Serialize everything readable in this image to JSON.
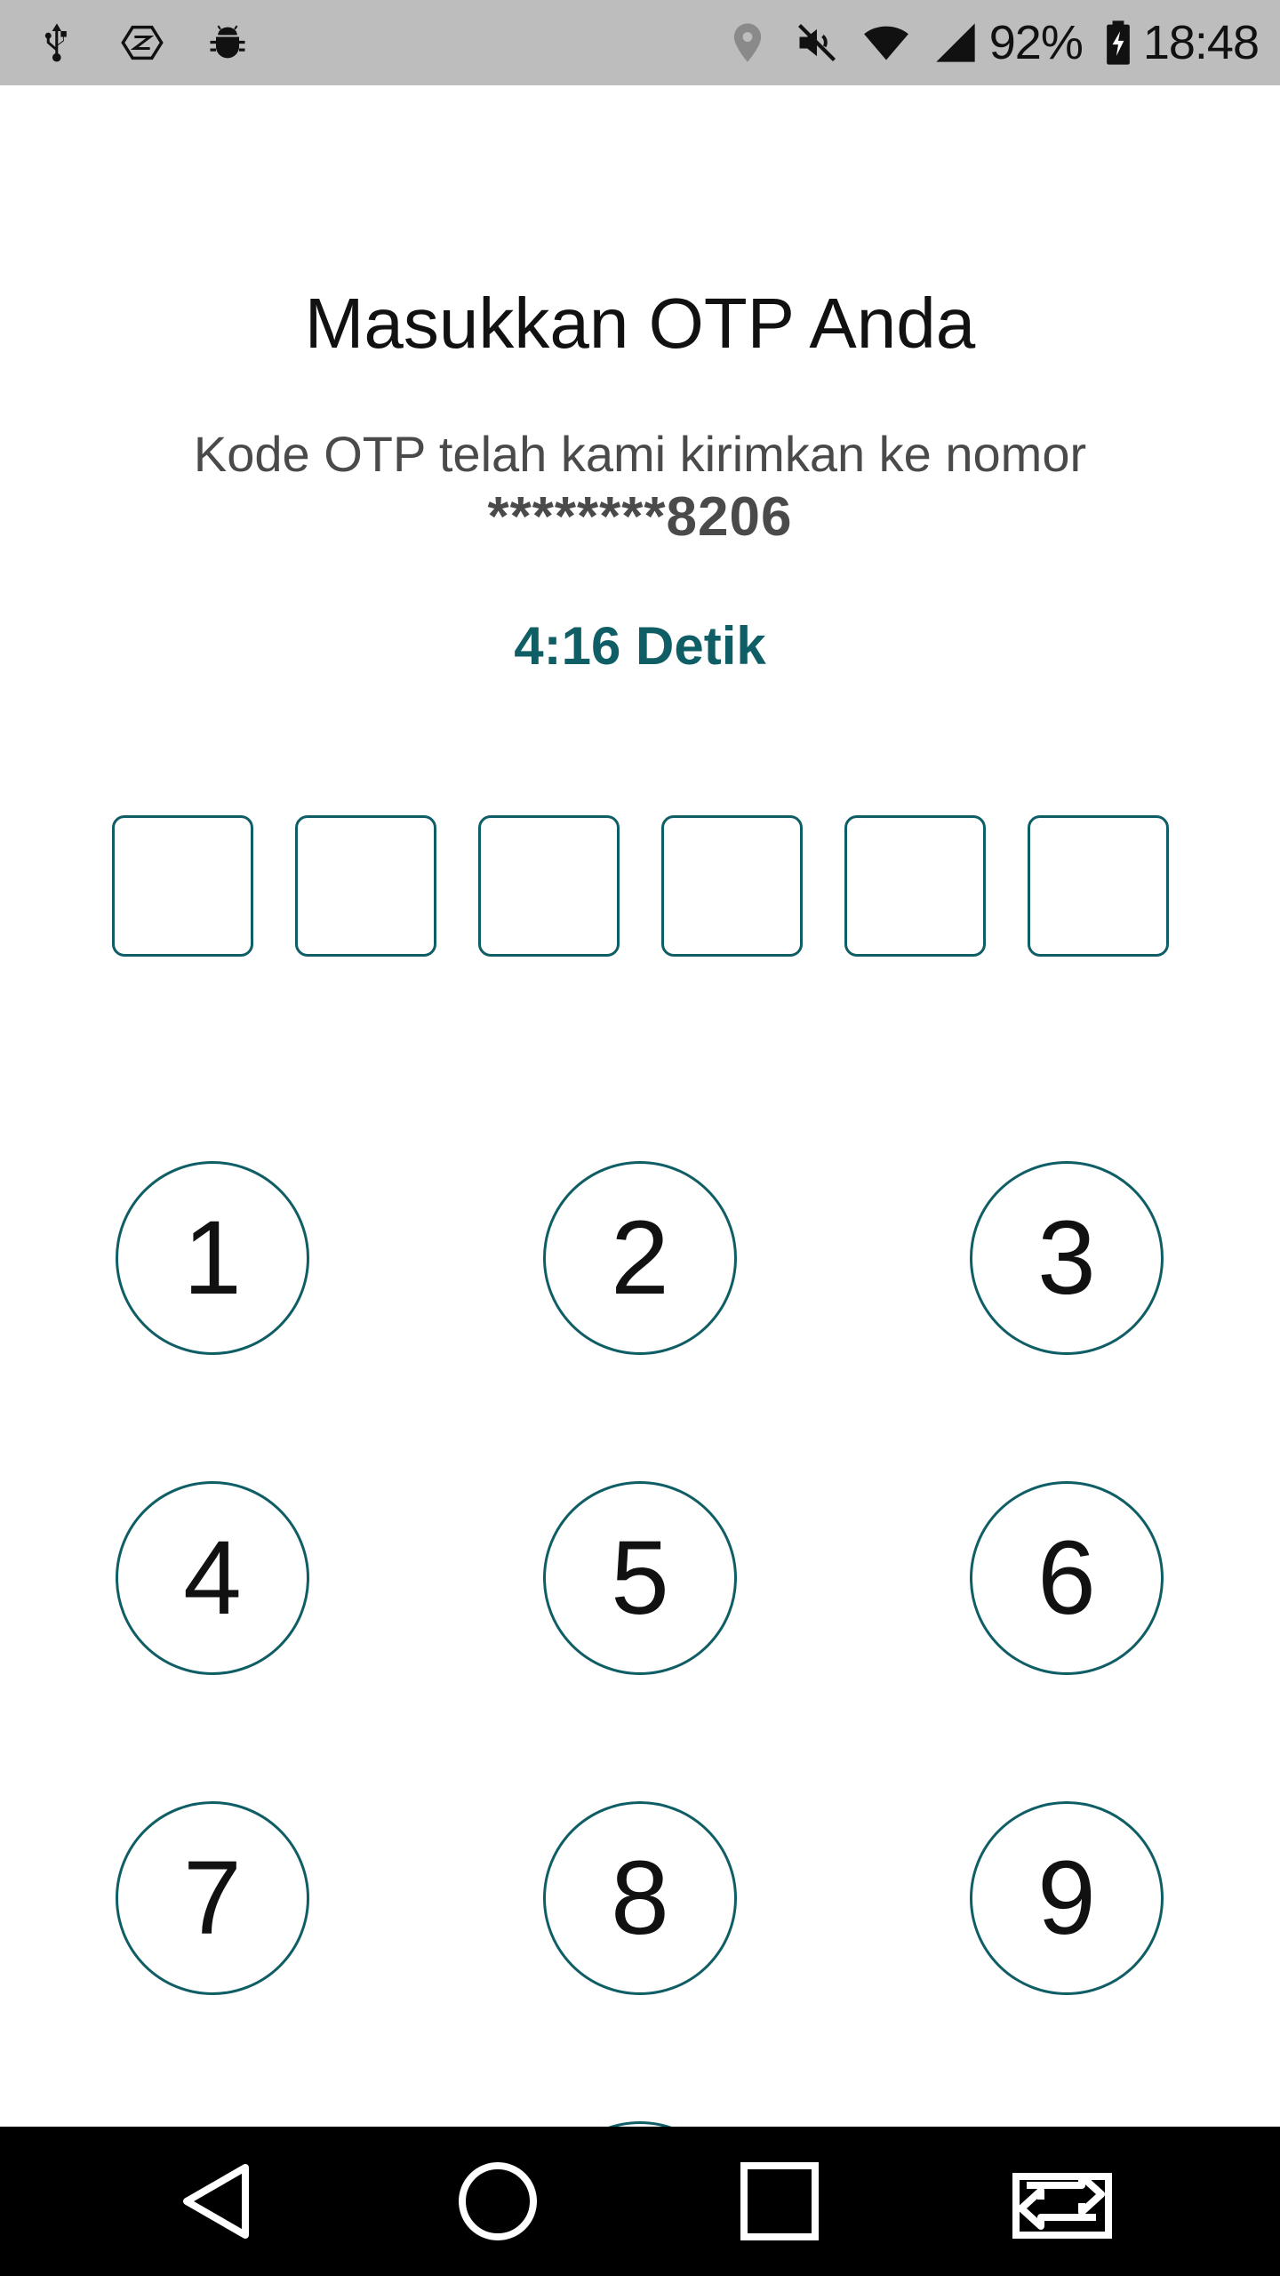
{
  "status_bar": {
    "icons_left": [
      "usb-icon",
      "nfc-icon",
      "debug-icon"
    ],
    "icons_right": [
      "location-icon",
      "mute-icon",
      "wifi-icon",
      "signal-icon"
    ],
    "battery_percent": "92%",
    "time": "18:48",
    "battery_icon": "battery-charging-icon"
  },
  "header": {
    "title": "Masukkan OTP Anda",
    "subtitle": "Kode OTP telah kami kirimkan ke nomor",
    "phone_masked": "********8206",
    "timer": "4:16 Detik"
  },
  "otp": {
    "length": 6
  },
  "keypad": {
    "keys": [
      "1",
      "2",
      "3",
      "4",
      "5",
      "6",
      "7",
      "8",
      "9"
    ]
  },
  "nav_bar": {
    "buttons": [
      "back-icon",
      "home-icon",
      "recents-icon",
      "screen-switch-icon"
    ]
  },
  "colors": {
    "accent": "#0f5e66",
    "status_bar_bg": "#bdbdbd",
    "nav_bar_bg": "#000000",
    "text_primary": "#111111",
    "text_secondary": "#4a4a4a"
  }
}
